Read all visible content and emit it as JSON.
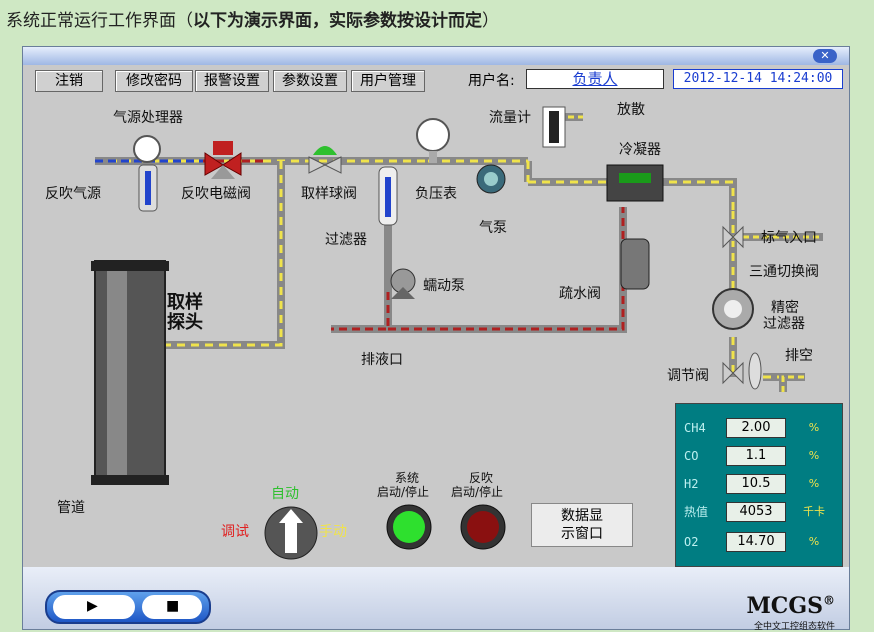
{
  "caption": {
    "plain": "系统正常运行工作界面（",
    "bold": "以下为演示界面，实际参数按设计而定",
    "end": "）"
  },
  "toolbar": {
    "logout": "注销",
    "change_password": "修改密码",
    "alarm_settings": "报警设置",
    "param_settings": "参数设置",
    "user_mgmt": "用户管理"
  },
  "user": {
    "label": "用户名:",
    "name": "负责人"
  },
  "datetime": "2012-12-14 14:24:00",
  "labels": {
    "air_source_processor": "气源处理器",
    "backflow_source": "反吹气源",
    "backflow_valve": "反吹电磁阀",
    "sampling_valve": "取样球阀",
    "neg_pressure_gauge": "负压表",
    "flowmeter": "流量计",
    "vent": "放散",
    "condenser": "冷凝器",
    "filter": "过滤器",
    "air_pump": "气泵",
    "peristaltic_pump": "蠕动泵",
    "drain_valve": "疏水阀",
    "calib_inlet": "标气入口",
    "three_way_valve": "三通切换阀",
    "precision_filter_1": "精密",
    "precision_filter_2": "过滤器",
    "exhaust": "排空",
    "regulating_valve": "调节阀",
    "drain_outlet": "排液口",
    "sampling_probe_1": "取样",
    "sampling_probe_2": "探头",
    "pipe": "管道"
  },
  "controls": {
    "auto": "自动",
    "debug": "调试",
    "manual": "手动",
    "system_start_stop_1": "系统",
    "system_start_stop_2": "启动/停止",
    "backflow_start_stop_1": "反吹",
    "backflow_start_stop_2": "启动/停止",
    "data_display_1": "数据显",
    "data_display_2": "示窗口"
  },
  "readings": [
    {
      "name": "CH4",
      "value": "2.00",
      "unit": "%"
    },
    {
      "name": "CO",
      "value": "1.1",
      "unit": "%"
    },
    {
      "name": "H2",
      "value": "10.5",
      "unit": "%"
    },
    {
      "name": "热值",
      "value": "4053",
      "unit": "千卡"
    },
    {
      "name": "O2",
      "value": "14.70",
      "unit": "%"
    }
  ],
  "brand": {
    "name": "MCGS",
    "reg": "®",
    "subtitle": "全中文工控组态软件"
  },
  "colors": {
    "background": "#c9c9c9",
    "panel": "#007d82",
    "pipe_yellow": "#f0e34b",
    "pipe_red": "#b02020",
    "start_green": "#2ee02e",
    "stop_red": "#8a1010"
  }
}
